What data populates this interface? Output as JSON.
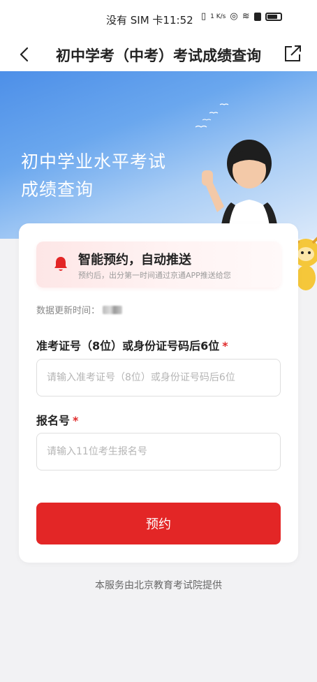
{
  "status_bar": {
    "carrier_time": "没有 SIM 卡11:52",
    "speed": "1 K/s",
    "icons": [
      "vibrate-icon",
      "speed-icon",
      "hotspot-icon",
      "wifi-icon",
      "alert-icon",
      "battery-icon"
    ]
  },
  "nav": {
    "title": "初中学考（中考）考试成绩查询",
    "back_icon": "back-arrow-icon",
    "share_icon": "share-icon"
  },
  "banner": {
    "title_line1": "初中学业水平考试",
    "title_line2": "成绩查询"
  },
  "notify": {
    "title": "智能预约，自动推送",
    "subtitle": "预约后，出分第一时间通过京通APP推送给您",
    "icon": "bell-icon"
  },
  "form": {
    "update_label": "数据更新时间：",
    "field1_label": "准考证号（8位）或身份证号码后6位",
    "field1_required": "*",
    "field1_placeholder": "请输入准考证号（8位）或身份证号码后6位",
    "field2_label": "报名号",
    "field2_required": "*",
    "field2_placeholder": "请输入11位考生报名号",
    "submit_label": "预约"
  },
  "footer": "本服务由北京教育考试院提供",
  "colors": {
    "accent": "#e32626",
    "banner": "#5b9bec"
  }
}
